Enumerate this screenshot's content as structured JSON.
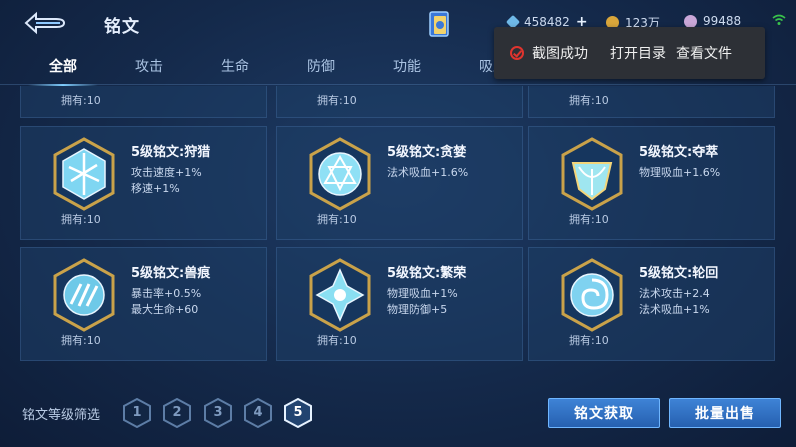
{
  "header": {
    "title": "铭文",
    "currencies": [
      {
        "icon": "diamond-icon",
        "value": "458482",
        "has_plus": true
      },
      {
        "icon": "gold-coin-icon",
        "value": "123万",
        "has_plus": false
      },
      {
        "icon": "inscription-shard-icon",
        "value": "99488",
        "has_plus": false
      }
    ]
  },
  "tabs": [
    "全部",
    "攻击",
    "生命",
    "防御",
    "功能",
    "吸血"
  ],
  "active_tab": "全部",
  "toast": {
    "message": "截图成功",
    "open_dir": "打开目录",
    "view_file": "查看文件"
  },
  "partial_row": [
    {
      "owned": "拥有:10"
    },
    {
      "owned": "拥有:10"
    },
    {
      "owned": "拥有:10"
    }
  ],
  "cards": [
    {
      "name": "5级铭文:狩猎",
      "attrs": [
        "攻击速度+1%",
        "移速+1%"
      ],
      "owned": "拥有:10",
      "gem_color": "#7fd6f2"
    },
    {
      "name": "5级铭文:贪婪",
      "attrs": [
        "法术吸血+1.6%"
      ],
      "owned": "拥有:10",
      "gem_color": "#8fe0f5"
    },
    {
      "name": "5级铭文:夺萃",
      "attrs": [
        "物理吸血+1.6%"
      ],
      "owned": "拥有:10",
      "gem_color": "#9fe6f0"
    },
    {
      "name": "5级铭文:兽痕",
      "attrs": [
        "暴击率+0.5%",
        "最大生命+60"
      ],
      "owned": "拥有:10",
      "gem_color": "#6ec9e8"
    },
    {
      "name": "5级铭文:繁荣",
      "attrs": [
        "物理吸血+1%",
        "物理防御+5"
      ],
      "owned": "拥有:10",
      "gem_color": "#8adff2"
    },
    {
      "name": "5级铭文:轮回",
      "attrs": [
        "法术攻击+2.4",
        "法术吸血+1%"
      ],
      "owned": "拥有:10",
      "gem_color": "#7fd2f0"
    }
  ],
  "footer": {
    "filter_label": "铭文等级筛选",
    "levels": [
      "1",
      "2",
      "3",
      "4",
      "5"
    ],
    "selected_level": "5",
    "obtain_button": "铭文获取",
    "sell_button": "批量出售"
  },
  "colors": {
    "accent": "#3e83d6",
    "gold": "#c9a24a",
    "toast_bg": "#2d3036",
    "toast_icon": "#e0342e"
  }
}
